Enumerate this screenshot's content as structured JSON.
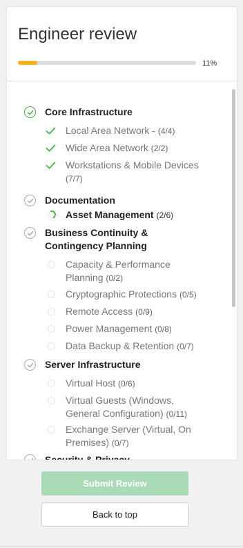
{
  "header": {
    "title": "Engineer review",
    "progress_fraction": 0.11,
    "progress_label": "11%",
    "progress_color": "#f5b21b"
  },
  "sections": [
    {
      "name": "Core Infrastructure",
      "status": "complete",
      "items": [
        {
          "label": "Local Area Network - ",
          "count": "(4/4)",
          "status": "complete"
        },
        {
          "label": "Wide Area Network ",
          "count": "(2/2)",
          "status": "complete"
        },
        {
          "label": "Workstations & Mobile Devices ",
          "count": "(7/7)",
          "status": "complete"
        }
      ]
    },
    {
      "name": "Documentation",
      "status": "incomplete",
      "items": [
        {
          "label": "Asset Management ",
          "count": "(2/6)",
          "status": "in-progress"
        }
      ]
    },
    {
      "name": "Business Continuity & Contingency Planning",
      "status": "incomplete",
      "items": [
        {
          "label": "Capacity & Performance Planning ",
          "count": "(0/2)",
          "status": "pending"
        },
        {
          "label": "Cryptographic Protections ",
          "count": "(0/5)",
          "status": "pending"
        },
        {
          "label": "Remote Access ",
          "count": "(0/9)",
          "status": "pending"
        },
        {
          "label": "Power Management ",
          "count": "(0/8)",
          "status": "pending"
        },
        {
          "label": "Data Backup & Retention ",
          "count": "(0/7)",
          "status": "pending"
        }
      ]
    },
    {
      "name": "Server Infrastructure",
      "status": "incomplete",
      "items": [
        {
          "label": "Virtual Host ",
          "count": "(0/6)",
          "status": "pending"
        },
        {
          "label": "Virtual Guests (Windows, General Configuration) ",
          "count": "(0/11)",
          "status": "pending"
        },
        {
          "label": "Exchange Server (Virtual, On Premises) ",
          "count": "(0/7)",
          "status": "pending"
        }
      ]
    },
    {
      "name": "Security & Privacy",
      "status": "incomplete",
      "items": []
    }
  ],
  "actions": {
    "submit_label": "Submit Review",
    "back_label": "Back to top"
  },
  "colors": {
    "complete": "#4caf50",
    "submit_disabled": "#a9dcb6"
  }
}
